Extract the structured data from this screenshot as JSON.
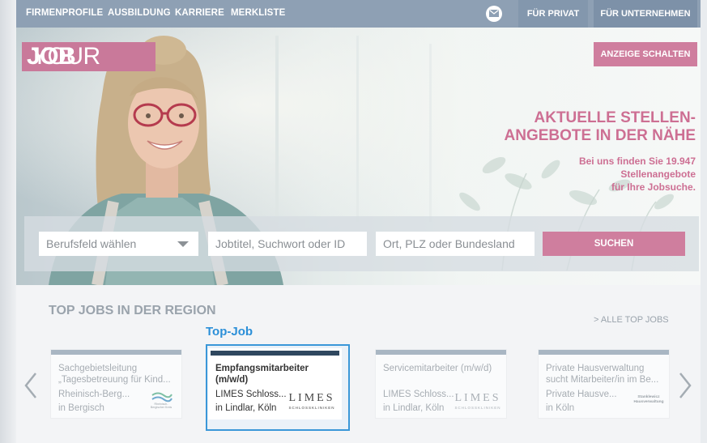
{
  "nav": {
    "items": [
      "FIRMENPROFILE",
      "AUSBILDUNG",
      "KARRIERE",
      "MERKLISTE"
    ],
    "private_label": "FÜR PRIVAT",
    "business_label": "FÜR UNTERNEHMEN"
  },
  "hero": {
    "logo_light": "YOUR",
    "logo_bold": "JOB",
    "ad_button": "ANZEIGE SCHALTEN",
    "title_line1": "AKTUELLE STELLEN-",
    "title_line2": "ANGEBOTE IN DER NÄHE",
    "sub_line1": "Bei uns finden Sie 19.947",
    "sub_line2": "Stellenangebote",
    "sub_line3": "für Ihre Jobsuche."
  },
  "search": {
    "category_placeholder": "Berufsfeld wählen",
    "job_placeholder": "Jobtitel, Suchwort oder ID",
    "location_placeholder": "Ort, PLZ oder Bundesland",
    "submit_label": "SUCHEN"
  },
  "top_jobs": {
    "title": "TOP JOBS IN DER REGION",
    "all_link": "> ALLE TOP JOBS",
    "highlight_label": "Top-Job",
    "cards": [
      {
        "title_line1": "Sachgebietsleitung",
        "title_line2": "„Tagesbetreuung für Kind...",
        "company": "Rheinisch-Berg...",
        "city": "in Bergisch",
        "logo_text": "Rheinisch-Bergischer Kreis"
      },
      {
        "title_line1": "Empfangsmitarbeiter",
        "title_line2": "(m/w/d)",
        "company": "LIMES Schloss...",
        "city": "in Lindlar, Köln",
        "logo_text": "LIMES",
        "logo_sub": "SCHLOSSKLINIKEN"
      },
      {
        "title_line1": "Servicemitarbeiter (m/w/d)",
        "title_line2": "",
        "company": "LIMES Schloss...",
        "city": "in Lindlar, Köln",
        "logo_text": "LIMES",
        "logo_sub": "SCHLOSSKLINIKEN"
      },
      {
        "title_line1": "Private Hausverwaltung",
        "title_line2": "sucht Mitarbeiter/in im Be...",
        "company": "Private Hausve...",
        "city": "in Köln",
        "logo_text": "Stanklewicz",
        "logo_sub": "Hausverwaltung"
      }
    ]
  },
  "colors": {
    "accent_pink": "#cf7e9e",
    "nav_blue": "#8ea0b4",
    "highlight_blue": "#3a97d8"
  }
}
